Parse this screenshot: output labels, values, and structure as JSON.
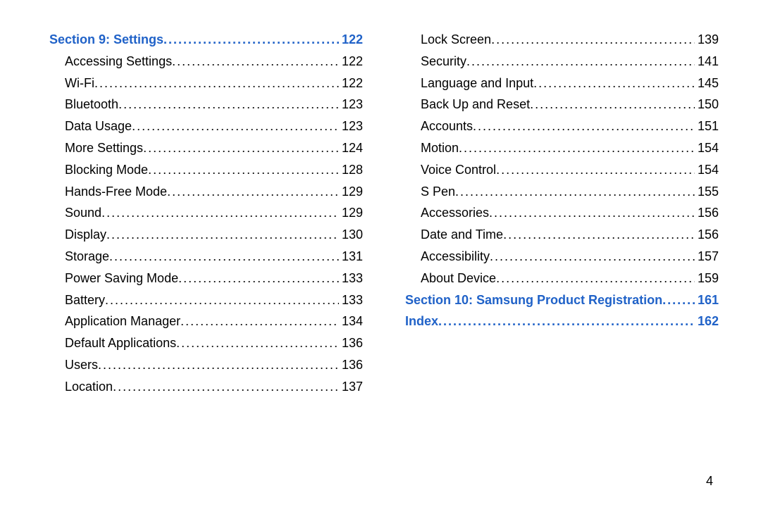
{
  "page_number": "4",
  "left_column": [
    {
      "type": "section",
      "label": "Section 9:  Settings",
      "page": "122"
    },
    {
      "type": "item",
      "label": "Accessing Settings",
      "page": "122"
    },
    {
      "type": "item",
      "label": "Wi-Fi",
      "page": "122"
    },
    {
      "type": "item",
      "label": "Bluetooth",
      "page": "123"
    },
    {
      "type": "item",
      "label": "Data Usage",
      "page": "123"
    },
    {
      "type": "item",
      "label": "More Settings",
      "page": "124"
    },
    {
      "type": "item",
      "label": "Blocking Mode",
      "page": "128"
    },
    {
      "type": "item",
      "label": "Hands-Free Mode",
      "page": "129"
    },
    {
      "type": "item",
      "label": "Sound",
      "page": "129"
    },
    {
      "type": "item",
      "label": "Display",
      "page": "130"
    },
    {
      "type": "item",
      "label": "Storage",
      "page": "131"
    },
    {
      "type": "item",
      "label": "Power Saving Mode",
      "page": "133"
    },
    {
      "type": "item",
      "label": "Battery",
      "page": "133"
    },
    {
      "type": "item",
      "label": "Application Manager",
      "page": "134"
    },
    {
      "type": "item",
      "label": "Default Applications",
      "page": "136"
    },
    {
      "type": "item",
      "label": "Users",
      "page": "136"
    },
    {
      "type": "item",
      "label": "Location",
      "page": "137"
    }
  ],
  "right_column": [
    {
      "type": "item",
      "label": "Lock Screen",
      "page": "139"
    },
    {
      "type": "item",
      "label": "Security",
      "page": "141"
    },
    {
      "type": "item",
      "label": "Language and Input",
      "page": "145"
    },
    {
      "type": "item",
      "label": "Back Up and Reset",
      "page": "150"
    },
    {
      "type": "item",
      "label": "Accounts",
      "page": "151"
    },
    {
      "type": "item",
      "label": "Motion",
      "page": "154"
    },
    {
      "type": "item",
      "label": "Voice Control",
      "page": "154"
    },
    {
      "type": "item",
      "label": "S Pen",
      "page": "155"
    },
    {
      "type": "item",
      "label": "Accessories",
      "page": "156"
    },
    {
      "type": "item",
      "label": "Date and Time",
      "page": "156"
    },
    {
      "type": "item",
      "label": "Accessibility",
      "page": "157"
    },
    {
      "type": "item",
      "label": "About Device",
      "page": "159"
    },
    {
      "type": "section",
      "label": "Section 10:  Samsung Product Registration",
      "page": "161"
    },
    {
      "type": "section",
      "label": "Index",
      "page": "162"
    }
  ]
}
